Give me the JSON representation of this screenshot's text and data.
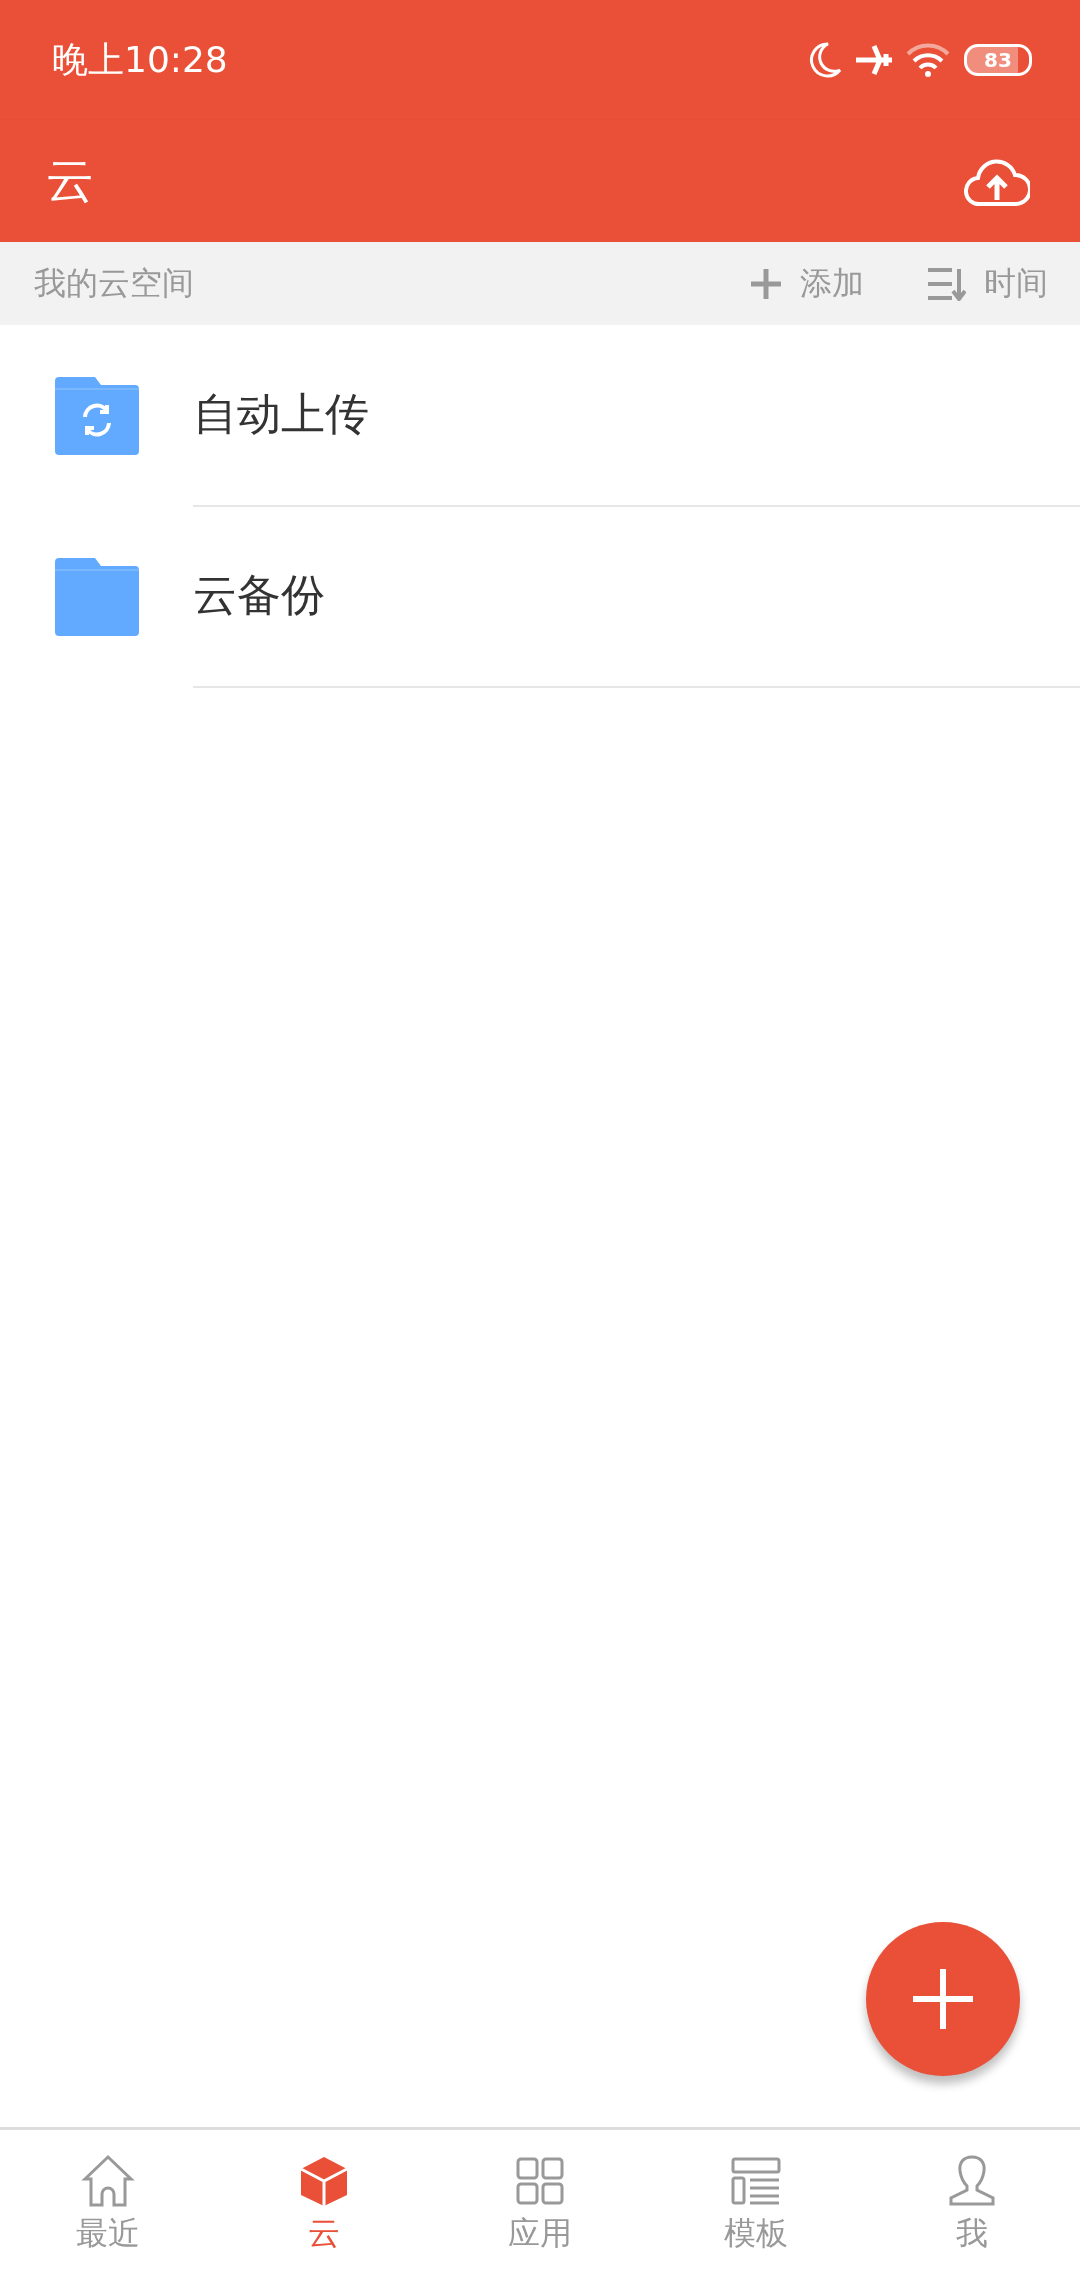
{
  "status_bar": {
    "time": "晚上10:28",
    "battery": "83"
  },
  "app_bar": {
    "title": "云"
  },
  "subheader": {
    "title": "我的云空间",
    "actions": [
      {
        "kind": "add",
        "label": "添加"
      },
      {
        "kind": "sort",
        "label": "时间"
      }
    ]
  },
  "folders": [
    {
      "kind": "sync",
      "name": "自动上传"
    },
    {
      "kind": "plain",
      "name": "云备份"
    }
  ],
  "bottom_nav": [
    {
      "kind": "home",
      "label": "最近",
      "selected": false
    },
    {
      "kind": "cube",
      "label": "云",
      "selected": true
    },
    {
      "kind": "grid",
      "label": "应用",
      "selected": false
    },
    {
      "kind": "template",
      "label": "模板",
      "selected": false
    },
    {
      "kind": "person",
      "label": "我",
      "selected": false
    }
  ]
}
